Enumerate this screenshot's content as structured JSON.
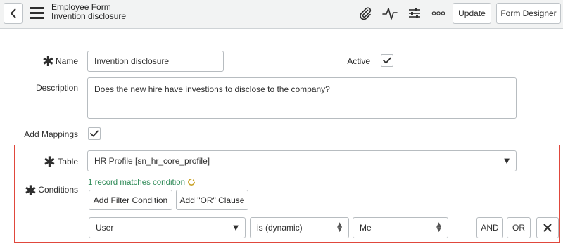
{
  "header": {
    "title": "Employee Form",
    "subtitle": "Invention disclosure",
    "update_label": "Update",
    "form_designer_label": "Form Designer"
  },
  "form": {
    "name_label": "Name",
    "name_value": "Invention disclosure",
    "active_label": "Active",
    "active_checked": true,
    "description_label": "Description",
    "description_value": "Does the new hire have investions to disclose to the company?",
    "add_mappings_label": "Add Mappings",
    "add_mappings_checked": true
  },
  "mapping": {
    "table_label": "Table",
    "table_value": "HR Profile [sn_hr_core_profile]",
    "conditions_label": "Conditions",
    "record_match_text": "1 record matches condition",
    "add_filter_label": "Add Filter Condition",
    "add_or_label": "Add \"OR\" Clause",
    "condition": {
      "field": "User",
      "operator": "is (dynamic)",
      "value": "Me"
    },
    "and_label": "AND",
    "or_label": "OR"
  },
  "colors": {
    "accent_green": "#278efc",
    "section_border": "#e0473c"
  }
}
